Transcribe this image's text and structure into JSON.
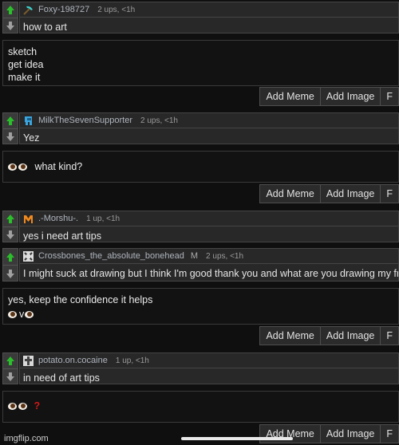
{
  "comments": [
    {
      "username": "Foxy-198727",
      "meta": "2 ups, <1h",
      "text": "how to art",
      "avatar_icon": "diamond-pickaxe-icon"
    },
    {
      "username": "MilkTheSevenSupporter",
      "meta": "2 ups, <1h",
      "text": "Yez",
      "avatar_icon": "blue-creature-icon"
    },
    {
      "username": ".-Morshu-.",
      "meta": "1 up, <1h",
      "text": "yes i need art tips",
      "avatar_icon": "orange-m-icon"
    },
    {
      "username": "Crossbones_the_absolute_bonehead",
      "badge": "M",
      "meta": "2 ups, <1h",
      "text": "I might suck at drawing but I think I'm good thank you and what are you drawing my friend",
      "avatar_icon": "crossbones-icon"
    },
    {
      "username": "potato.on.cocaine",
      "meta": "1 up, <1h",
      "text": "in need of art tips",
      "avatar_icon": "cross-icon"
    }
  ],
  "replies": [
    {
      "lines": [
        "sketch",
        "get idea",
        "make it"
      ]
    },
    {
      "lines": [
        "what kind?"
      ]
    },
    {
      "lines": [
        "yes, keep the confidence it helps",
        "v"
      ]
    },
    {
      "lines": [
        "?"
      ]
    }
  ],
  "buttons": {
    "add_meme": "Add Meme",
    "add_image": "Add Image",
    "third": "F"
  },
  "watermark": "imgflip.com",
  "colors": {
    "upvote": "#2bbf2b",
    "downvote": "#a0a0a0",
    "username": "#aeb4bd",
    "red_q": "#d01818"
  }
}
